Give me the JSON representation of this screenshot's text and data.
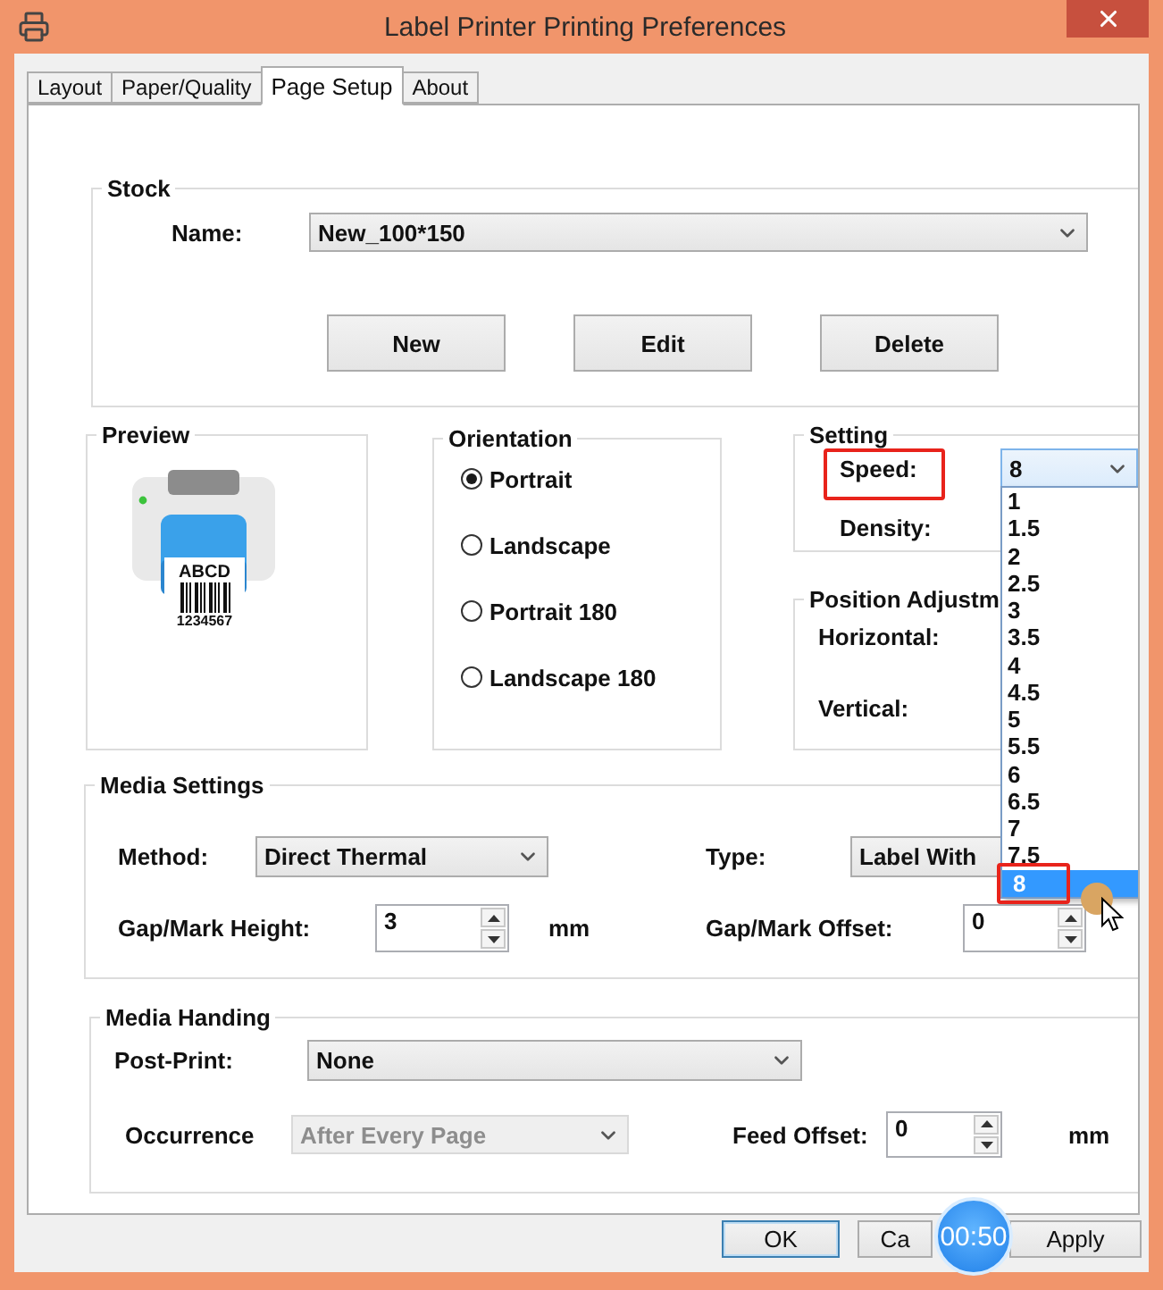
{
  "window": {
    "title": "Label Printer Printing Preferences"
  },
  "tabs": [
    {
      "label": "Layout",
      "selected": false
    },
    {
      "label": "Paper/Quality",
      "selected": false
    },
    {
      "label": "Page Setup",
      "selected": true
    },
    {
      "label": "About",
      "selected": false
    }
  ],
  "stock": {
    "title": "Stock",
    "name_label": "Name:",
    "name_value": "New_100*150",
    "buttons": [
      "New",
      "Edit",
      "Delete"
    ]
  },
  "preview": {
    "title": "Preview",
    "label_text": "ABCD",
    "barcode_number": "1234567"
  },
  "orientation": {
    "title": "Orientation",
    "options": [
      {
        "label": "Portrait",
        "selected": true
      },
      {
        "label": "Landscape",
        "selected": false
      },
      {
        "label": "Portrait 180",
        "selected": false
      },
      {
        "label": "Landscape 180",
        "selected": false
      }
    ]
  },
  "setting": {
    "title": "Setting",
    "speed_label": "Speed:",
    "speed_value": "8",
    "speed_highlighted": true,
    "density_label": "Density:"
  },
  "speed_dropdown": {
    "options": [
      {
        "label": "1",
        "selected": false,
        "highlighted": false
      },
      {
        "label": "1.5",
        "selected": false,
        "highlighted": false
      },
      {
        "label": "2",
        "selected": false,
        "highlighted": false
      },
      {
        "label": "2.5",
        "selected": false,
        "highlighted": false
      },
      {
        "label": "3",
        "selected": false,
        "highlighted": false
      },
      {
        "label": "3.5",
        "selected": false,
        "highlighted": false
      },
      {
        "label": "4",
        "selected": false,
        "highlighted": false
      },
      {
        "label": "4.5",
        "selected": false,
        "highlighted": false
      },
      {
        "label": "5",
        "selected": false,
        "highlighted": false
      },
      {
        "label": "5.5",
        "selected": false,
        "highlighted": false
      },
      {
        "label": "6",
        "selected": false,
        "highlighted": false
      },
      {
        "label": "6.5",
        "selected": false,
        "highlighted": false
      },
      {
        "label": "7",
        "selected": false,
        "highlighted": false
      },
      {
        "label": "7.5",
        "selected": false,
        "highlighted": false
      },
      {
        "label": "8",
        "selected": true,
        "highlighted": true
      }
    ]
  },
  "position_adjustment": {
    "title": "Position Adjustm",
    "horizontal_label": "Horizontal:",
    "vertical_label": "Vertical:"
  },
  "media_settings": {
    "title": "Media Settings",
    "method_label": "Method:",
    "method_value": "Direct Thermal",
    "type_label": "Type:",
    "type_value": "Label With",
    "gap_height_label": "Gap/Mark Height:",
    "gap_height_value": "3",
    "gap_height_unit": "mm",
    "gap_offset_label": "Gap/Mark Offset:",
    "gap_offset_value": "0"
  },
  "media_handling": {
    "title": "Media Handing",
    "post_print_label": "Post-Print:",
    "post_print_value": "None",
    "occurrence_label": "Occurrence",
    "occurrence_value": "After Every Page",
    "occurrence_disabled": true,
    "feed_offset_label": "Feed Offset:",
    "feed_offset_value": "0",
    "feed_offset_unit": "mm"
  },
  "buttons": [
    {
      "label": "OK",
      "focused": true
    },
    {
      "label": "Ca",
      "focused": false
    },
    {
      "label": "Apply",
      "focused": false
    }
  ],
  "timer_badge": "00:50"
}
